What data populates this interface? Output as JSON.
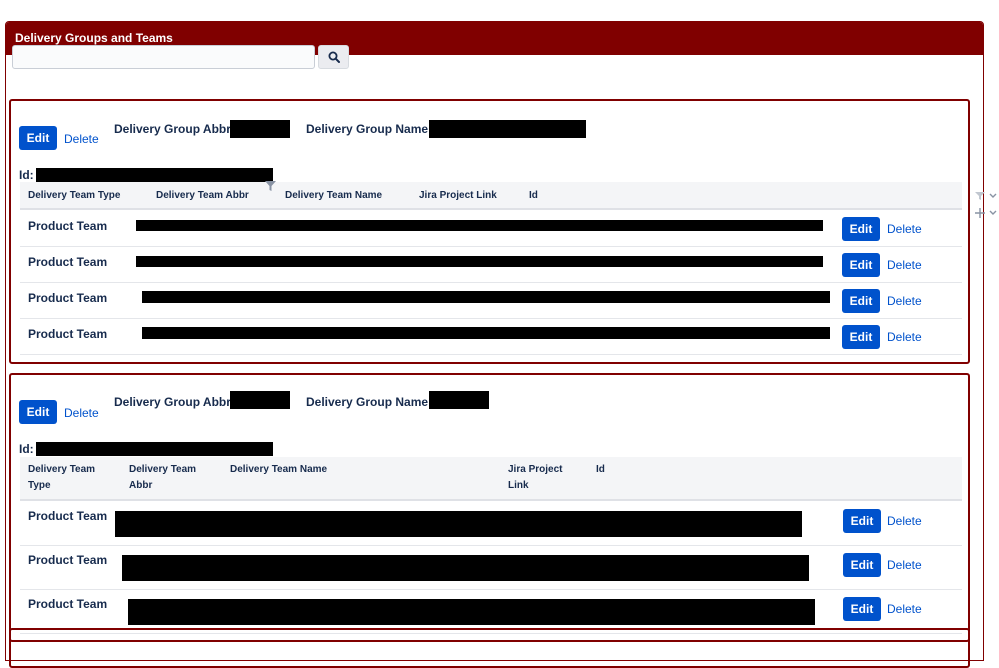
{
  "panel": {
    "title": "Delivery Groups and Teams"
  },
  "search": {
    "placeholder": "",
    "value": "",
    "icon": "search-icon"
  },
  "groups": [
    {
      "edit_label": "Edit",
      "delete_label": "Delete",
      "abbr_label": "Delivery Group Abbr:",
      "name_label": "Delivery Group Name:",
      "id_label": "Id:",
      "columns": [
        "Delivery Team Type",
        "Delivery Team Abbr",
        "Delivery Team Name",
        "Jira Project Link",
        "Id"
      ],
      "rows": [
        {
          "type": "Product Team",
          "edit": "Edit",
          "delete": "Delete"
        },
        {
          "type": "Product Team",
          "edit": "Edit",
          "delete": "Delete"
        },
        {
          "type": "Product Team",
          "edit": "Edit",
          "delete": "Delete"
        },
        {
          "type": "Product Team",
          "edit": "Edit",
          "delete": "Delete"
        }
      ]
    },
    {
      "edit_label": "Edit",
      "delete_label": "Delete",
      "abbr_label": "Delivery Group Abbr:",
      "name_label": "Delivery Group Name:",
      "id_label": "Id:",
      "columns": [
        "Delivery Team Type",
        "Delivery Team Abbr",
        "Delivery Team Name",
        "Jira Project Link",
        "Id"
      ],
      "rows": [
        {
          "type": "Product Team",
          "edit": "Edit",
          "delete": "Delete"
        },
        {
          "type": "Product Team",
          "edit": "Edit",
          "delete": "Delete"
        },
        {
          "type": "Product Team",
          "edit": "Edit",
          "delete": "Delete"
        }
      ]
    }
  ],
  "colors": {
    "header_bg": "#800000",
    "button_bg": "#0052cc",
    "link": "#0052cc"
  }
}
